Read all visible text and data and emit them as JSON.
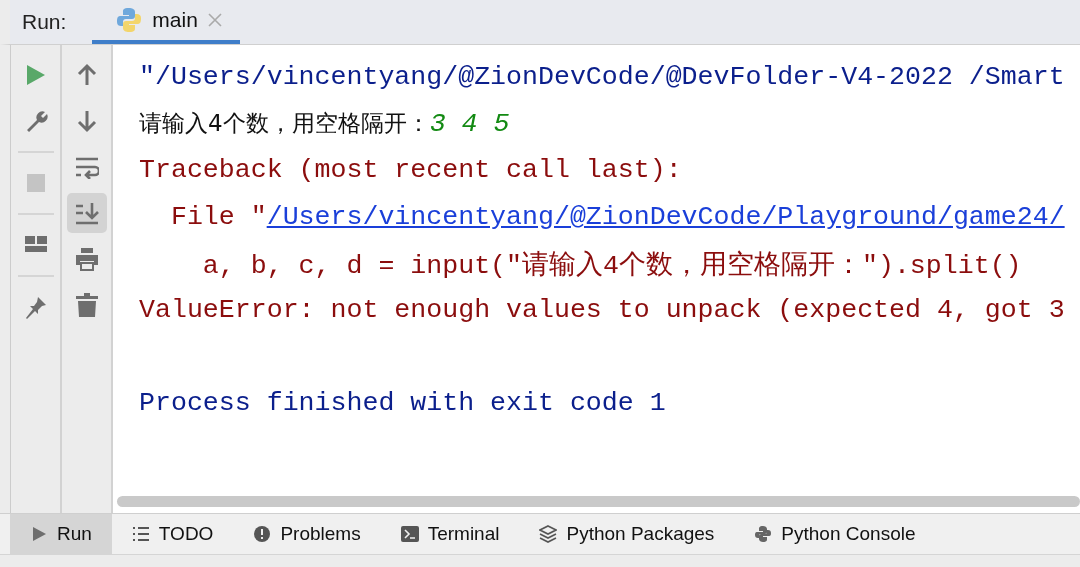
{
  "header": {
    "label": "Run:",
    "tabs": [
      {
        "label": "main",
        "selected": true,
        "closable": true
      }
    ]
  },
  "left_toolbar": [
    {
      "kind": "run",
      "disabled": false
    },
    {
      "kind": "settings",
      "disabled": false
    },
    {
      "kind": "separator"
    },
    {
      "kind": "stop",
      "disabled": true
    },
    {
      "kind": "separator"
    },
    {
      "kind": "layout",
      "disabled": false
    },
    {
      "kind": "separator"
    },
    {
      "kind": "pin",
      "disabled": false
    }
  ],
  "right_toolbar": [
    {
      "kind": "up",
      "selected": false
    },
    {
      "kind": "down",
      "selected": false
    },
    {
      "kind": "wrap",
      "selected": false
    },
    {
      "kind": "scroll-end",
      "selected": true
    },
    {
      "kind": "print",
      "selected": false
    },
    {
      "kind": "trash",
      "selected": false
    }
  ],
  "console": [
    [
      {
        "kind": "command",
        "text": "\"/Users/vincentyang/@ZionDevCode/@DevFolder-V4-2022 /Smart"
      }
    ],
    [
      {
        "kind": "prompt",
        "text": "请输入4个数，用空格隔开："
      },
      {
        "kind": "input",
        "text": "3 4 5"
      }
    ],
    [
      {
        "kind": "error",
        "text": "Traceback (most recent call last):"
      }
    ],
    [
      {
        "kind": "error",
        "text": "  File \""
      },
      {
        "kind": "link",
        "text": "/Users/vincentyang/@ZionDevCode/Playground/game24/"
      }
    ],
    [
      {
        "kind": "error",
        "text": "    a, b, c, d = input(\"请输入4个数，用空格隔开：\").split()"
      }
    ],
    [
      {
        "kind": "error",
        "text": "ValueError: not enough values to unpack (expected 4, got 3"
      }
    ],
    [
      {
        "kind": "blank"
      }
    ],
    [
      {
        "kind": "command",
        "text": "Process finished with exit code 1"
      }
    ]
  ],
  "bottom_tabs": [
    {
      "kind": "run",
      "label": "Run",
      "selected": true
    },
    {
      "kind": "todo",
      "label": "TODO",
      "selected": false
    },
    {
      "kind": "problems",
      "label": "Problems",
      "selected": false
    },
    {
      "kind": "terminal",
      "label": "Terminal",
      "selected": false
    },
    {
      "kind": "packages",
      "label": "Python Packages",
      "selected": false
    },
    {
      "kind": "python",
      "label": "Python Console",
      "selected": false
    }
  ]
}
